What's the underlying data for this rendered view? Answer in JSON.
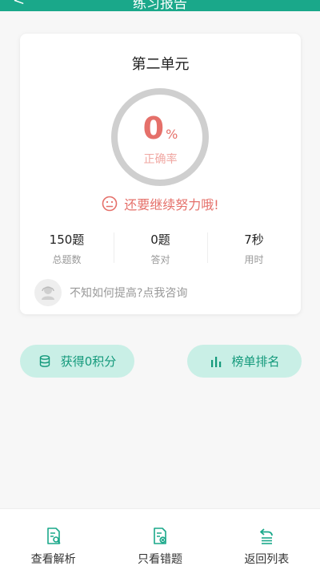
{
  "header": {
    "title": "练习报告",
    "back_glyph": "<"
  },
  "card": {
    "title": "第二单元",
    "percent_value": "0",
    "percent_unit": "%",
    "rate_label": "正确率",
    "encourage_text": "还要继续努力哦!",
    "stats": [
      {
        "value": "150题",
        "label": "总题数"
      },
      {
        "value": "0题",
        "label": "答对"
      },
      {
        "value": "7秒",
        "label": "用时"
      }
    ],
    "consult_text": "不知如何提高?点我咨询"
  },
  "actions": {
    "points_label": "获得0积分",
    "rank_label": "榜单排名"
  },
  "bottom_tabs": [
    {
      "label": "查看解析",
      "icon": "doc-search-icon"
    },
    {
      "label": "只看错题",
      "icon": "doc-error-icon"
    },
    {
      "label": "返回列表",
      "icon": "list-return-icon"
    }
  ],
  "colors": {
    "brand": "#1aa88a",
    "accent_red": "#e5706a",
    "pill_bg": "#c9efe6"
  }
}
